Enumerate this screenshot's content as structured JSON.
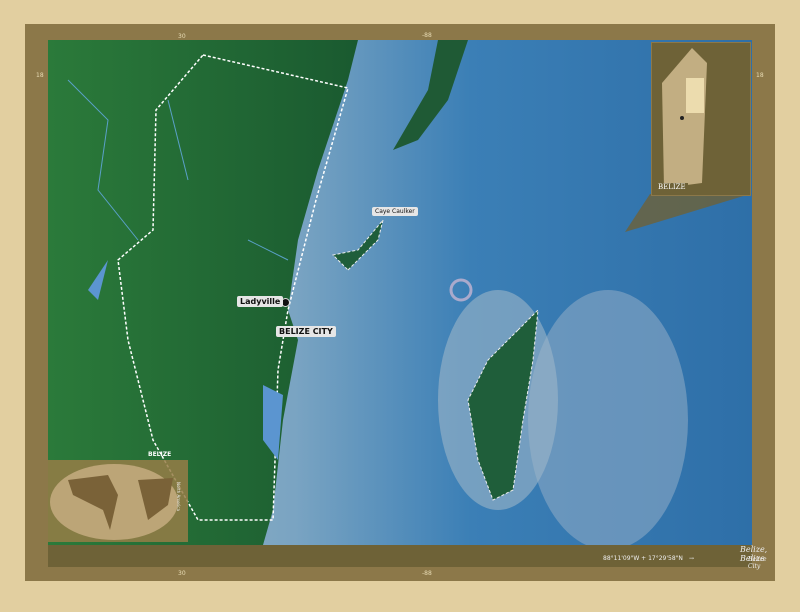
{
  "map": {
    "cities": [
      {
        "name": "Ladyville"
      },
      {
        "name": "Belize City"
      },
      {
        "name": "Caye Caulker"
      }
    ],
    "ticks": {
      "top": [
        "30",
        "-88"
      ],
      "left": [
        "18"
      ],
      "right": [
        "18"
      ],
      "bottom": [
        "30",
        "-88"
      ]
    },
    "inset_label": "Belize",
    "globe": {
      "label": "Belize",
      "region": "North America"
    },
    "title": "Belize, Belize",
    "subtitle": "Belize City",
    "coords": "88°11'09\"W + 17°29'58\"N",
    "arrow": "→"
  },
  "colors": {
    "land": "#1f5e33",
    "water": "#6f9dbc",
    "deep": "#2e73ad",
    "frame": "#8c7849",
    "background": "#e2cfa0"
  }
}
